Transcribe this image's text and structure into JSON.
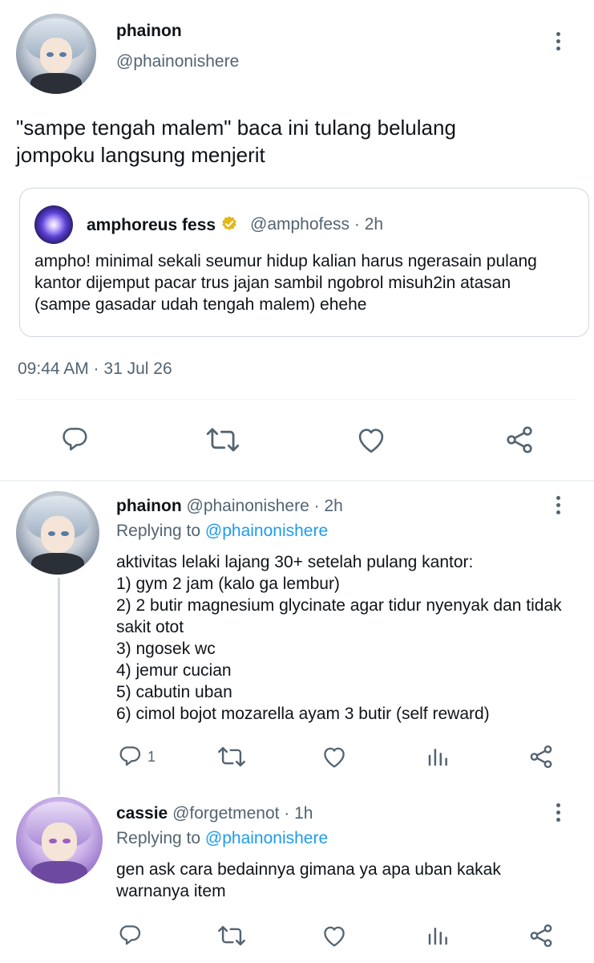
{
  "main_tweet": {
    "name": "phainon",
    "handle": "@phainonishere",
    "text": "\"sampe tengah malem\" baca ini tulang belulang jompoku langsung menjerit",
    "timestamp": "09:44 AM · 31 Jul 26",
    "quote": {
      "name": "amphoreus fess",
      "handle": "@amphofess · 2h",
      "text": "ampho! minimal sekali seumur hidup kalian harus ngerasain pulang kantor dijemput pacar trus jajan sambil ngobrol misuh2in atasan (sampe gasadar udah tengah malem) ehehe"
    },
    "actions": [
      "reply-icon",
      "retweet-icon",
      "like-icon",
      "share-icon"
    ]
  },
  "replies": [
    {
      "name": "phainon",
      "meta": "@phainonishere · 2h",
      "replying_prefix": "Replying to ",
      "replying_to": "@phainonishere",
      "text": "aktivitas lelaki lajang 30+ setelah pulang kantor:\n1) gym 2 jam (kalo ga lembur)\n2) 2 butir magnesium glycinate agar tidur nyenyak dan tidak sakit otot\n3) ngosek wc\n4) jemur cucian\n5) cabutin uban\n6) cimol bojot mozarella ayam 3 butir (self reward)",
      "reply_count": "1"
    },
    {
      "name": "cassie",
      "meta": "@forgetmenot · 1h",
      "replying_prefix": "Replying to ",
      "replying_to": "@phainonishere",
      "text": "gen ask cara bedainnya gimana ya apa uban kakak warnanya item",
      "reply_count": ""
    }
  ],
  "colors": {
    "accent": "#1d9bf0",
    "text": "#0f1419",
    "muted": "#536471",
    "border": "#cfd9de",
    "verified": "#e2b719"
  }
}
